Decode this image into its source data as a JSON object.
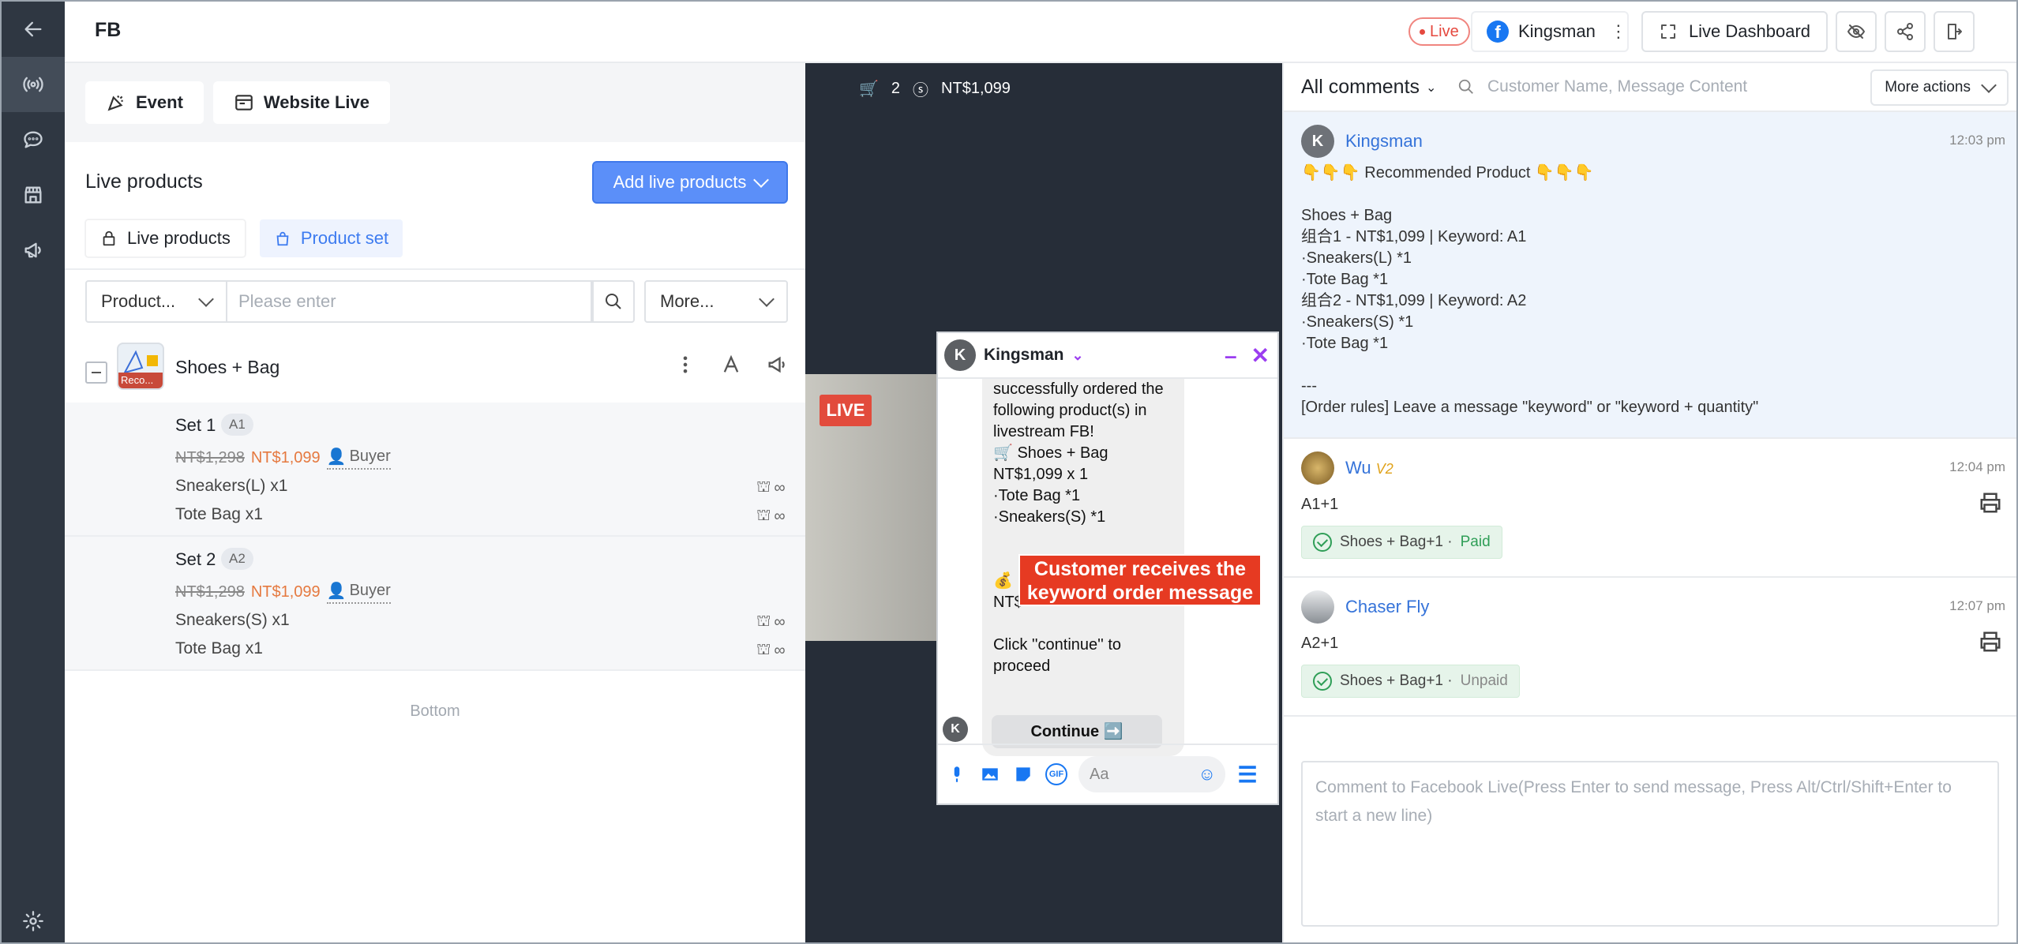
{
  "app": {
    "name": "FB"
  },
  "header": {
    "live_badge": "Live",
    "account_name": "Kingsman",
    "dashboard_label": "Live Dashboard",
    "icons": [
      "hide-icon",
      "share-icon",
      "exit-icon"
    ]
  },
  "rail": {
    "items": [
      "back-icon",
      "broadcast-icon",
      "chat-icon",
      "store-icon",
      "megaphone-icon",
      "settings-icon"
    ]
  },
  "left": {
    "tabs": [
      {
        "label": "Event",
        "icon": "party-icon"
      },
      {
        "label": "Website Live",
        "icon": "browser-icon"
      }
    ],
    "title": "Live products",
    "add_button": "Add live products",
    "subtabs": [
      {
        "label": "Live products"
      },
      {
        "label": "Product set"
      }
    ],
    "filter": {
      "select": "Product...",
      "placeholder": "Please enter",
      "more": "More..."
    },
    "product": {
      "name": "Shoes + Bag",
      "thumb_tag": "Reco...",
      "sets": [
        {
          "name": "Set 1",
          "keyword": "A1",
          "original": "NT$1,298",
          "price": "NT$1,099",
          "audience": "Buyer",
          "items": [
            {
              "label": "Sneakers(L) x1",
              "stock": "∞"
            },
            {
              "label": "Tote Bag x1",
              "stock": "∞"
            }
          ]
        },
        {
          "name": "Set 2",
          "keyword": "A2",
          "original": "NT$1,298",
          "price": "NT$1,099",
          "audience": "Buyer",
          "items": [
            {
              "label": "Sneakers(S) x1",
              "stock": "∞"
            },
            {
              "label": "Tote Bag x1",
              "stock": "∞"
            }
          ]
        }
      ]
    },
    "bottom_label": "Bottom"
  },
  "video": {
    "cart_count": "2",
    "total": "NT$1,099",
    "live_tag": "LIVE"
  },
  "messenger": {
    "name": "Kingsman",
    "avatar_letter": "K",
    "message": "successfully ordered the\nfollowing product(s) in\nlivestream FB!\n🛒 Shoes + Bag\nNT$1,099 x 1\n ·Tote Bag *1\n ·Sneakers(S) *1\n\n\n💰 \nNT$\n\nClick ''continue'' to\nproceed",
    "continue_label": "Continue ➡️",
    "input_placeholder": "Aa"
  },
  "callout": {
    "text": "Customer receives the keyword order message"
  },
  "comments": {
    "filter_label": "All comments",
    "search_placeholder": "Customer Name, Message Content",
    "more_actions": "More actions",
    "items": [
      {
        "name": "Kingsman",
        "avatar": "K",
        "time": "12:03 pm",
        "body": "👇👇👇 Recommended Product 👇👇👇\n\nShoes + Bag\n组合1 - NT$1,099 | Keyword: A1\n·Sneakers(L) *1\n·Tote Bag *1\n组合2 - NT$1,099 | Keyword: A2\n·Sneakers(S) *1\n·Tote Bag *1\n\n---\n[Order rules] Leave a message \"keyword\" or \"keyword + quantity\""
      },
      {
        "name": "Wu",
        "badge": "V2",
        "time": "12:04 pm",
        "body": "A1+1",
        "order_tag": "Shoes + Bag+1 ·",
        "status": "Paid"
      },
      {
        "name": "Chaser Fly",
        "time": "12:07 pm",
        "body": "A2+1",
        "order_tag": "Shoes + Bag+1 ·",
        "status": "Unpaid"
      }
    ],
    "compose_placeholder": "Comment to Facebook Live(Press Enter to send message, Press Alt/Ctrl/Shift+Enter to start a new line)"
  },
  "colors": {
    "accent": "#5b8ff9",
    "live": "#e5493f",
    "sale": "#e5793f",
    "paid": "#2f9e57",
    "callout": "#e63a22",
    "rail": "#2f3742",
    "video_bg": "#262d38"
  }
}
